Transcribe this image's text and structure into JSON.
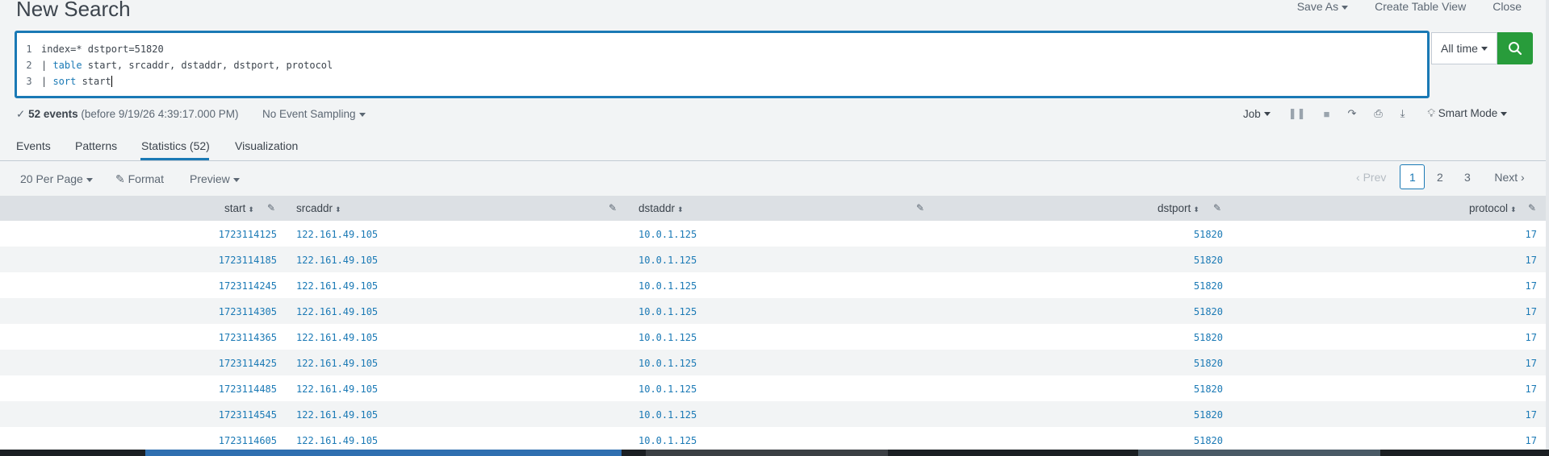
{
  "header": {
    "title": "New Search",
    "actions": [
      "Save As",
      "Create Table View",
      "Close"
    ]
  },
  "editor": {
    "lines": [
      {
        "num": "1",
        "text": "index=* dstport=51820"
      },
      {
        "num": "2",
        "pipe": "| ",
        "kw": "table",
        "rest": " start, srcaddr, dstaddr, dstport, protocol"
      },
      {
        "num": "3",
        "pipe": "| ",
        "kw": "sort",
        "rest": " start"
      }
    ]
  },
  "time_picker": {
    "label": "All time"
  },
  "status": {
    "count": "52 events",
    "detail": "(before 9/19/26 4:39:17.000 PM)",
    "sampling": "No Event Sampling"
  },
  "job_bar": {
    "job": "Job",
    "mode": "Smart Mode"
  },
  "tabs": [
    "Events",
    "Patterns",
    "Statistics (52)",
    "Visualization"
  ],
  "toolbar": {
    "per_page": "20 Per Page",
    "format": "Format",
    "preview": "Preview"
  },
  "pager": {
    "prev": "Prev",
    "pages": [
      "1",
      "2",
      "3"
    ],
    "next": "Next"
  },
  "table": {
    "columns": [
      "start",
      "srcaddr",
      "dstaddr",
      "dstport",
      "protocol"
    ],
    "rows": [
      [
        "1723114125",
        "122.161.49.105",
        "10.0.1.125",
        "51820",
        "17"
      ],
      [
        "1723114185",
        "122.161.49.105",
        "10.0.1.125",
        "51820",
        "17"
      ],
      [
        "1723114245",
        "122.161.49.105",
        "10.0.1.125",
        "51820",
        "17"
      ],
      [
        "1723114305",
        "122.161.49.105",
        "10.0.1.125",
        "51820",
        "17"
      ],
      [
        "1723114365",
        "122.161.49.105",
        "10.0.1.125",
        "51820",
        "17"
      ],
      [
        "1723114425",
        "122.161.49.105",
        "10.0.1.125",
        "51820",
        "17"
      ],
      [
        "1723114485",
        "122.161.49.105",
        "10.0.1.125",
        "51820",
        "17"
      ],
      [
        "1723114545",
        "122.161.49.105",
        "10.0.1.125",
        "51820",
        "17"
      ],
      [
        "1723114605",
        "122.161.49.105",
        "10.0.1.125",
        "51820",
        "17"
      ]
    ]
  },
  "colors": {
    "accent": "#1a79b5",
    "search_green": "#289c3b"
  }
}
